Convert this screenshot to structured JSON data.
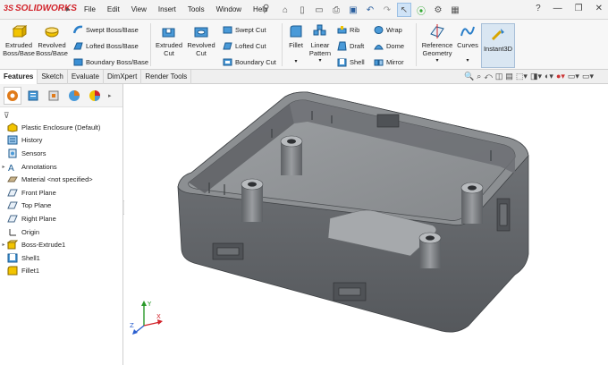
{
  "app": {
    "logo_ds": "3S",
    "logo_text": "SOLIDWORKS",
    "menus": [
      "File",
      "Edit",
      "View",
      "Insert",
      "Tools",
      "Window",
      "Help"
    ],
    "pin_icon": "pin-icon",
    "window_controls": [
      "?",
      "minimize",
      "restore",
      "close"
    ]
  },
  "ribbon": {
    "extruded_boss": "Extruded\nBoss/Base",
    "revolved_boss": "Revolved\nBoss/Base",
    "swept_boss": "Swept Boss/Base",
    "lofted_boss": "Lofted Boss/Base",
    "boundary_boss": "Boundary Boss/Base",
    "extruded_cut": "Extruded\nCut",
    "revolved_cut": "Revolved\nCut",
    "swept_cut": "Swept Cut",
    "lofted_cut": "Lofted Cut",
    "boundary_cut": "Boundary Cut",
    "fillet": "Fillet",
    "linear_pattern": "Linear\nPattern",
    "rib": "Rib",
    "draft": "Draft",
    "shell": "Shell",
    "wrap": "Wrap",
    "dome": "Dome",
    "mirror": "Mirror",
    "reference_geometry": "Reference\nGeometry",
    "curves": "Curves",
    "instant3d": "Instant3D"
  },
  "tabs": [
    "Features",
    "Sketch",
    "Evaluate",
    "DimXpert",
    "Render Tools"
  ],
  "active_tab": "Features",
  "tree": {
    "root": "Plastic Enclosure  (Default)",
    "items": [
      {
        "label": "History",
        "expandable": false,
        "icon": "history-icon"
      },
      {
        "label": "Sensors",
        "expandable": false,
        "icon": "sensor-icon"
      },
      {
        "label": "Annotations",
        "expandable": true,
        "icon": "annotations-icon"
      },
      {
        "label": "Material <not specified>",
        "expandable": false,
        "icon": "material-icon"
      },
      {
        "label": "Front Plane",
        "expandable": false,
        "icon": "plane-icon"
      },
      {
        "label": "Top Plane",
        "expandable": false,
        "icon": "plane-icon"
      },
      {
        "label": "Right Plane",
        "expandable": false,
        "icon": "plane-icon"
      },
      {
        "label": "Origin",
        "expandable": false,
        "icon": "origin-icon"
      },
      {
        "label": "Boss-Extrude1",
        "expandable": true,
        "icon": "extrude-feature-icon"
      },
      {
        "label": "Shell1",
        "expandable": false,
        "icon": "shell-feature-icon"
      },
      {
        "label": "Fillet1",
        "expandable": false,
        "icon": "fillet-feature-icon"
      }
    ]
  },
  "triad": {
    "x": "X",
    "y": "Y",
    "z": "Z"
  },
  "colors": {
    "accent": "#d2232a",
    "selection": "#cfe3f7",
    "part_gray": "#6c6f73"
  }
}
